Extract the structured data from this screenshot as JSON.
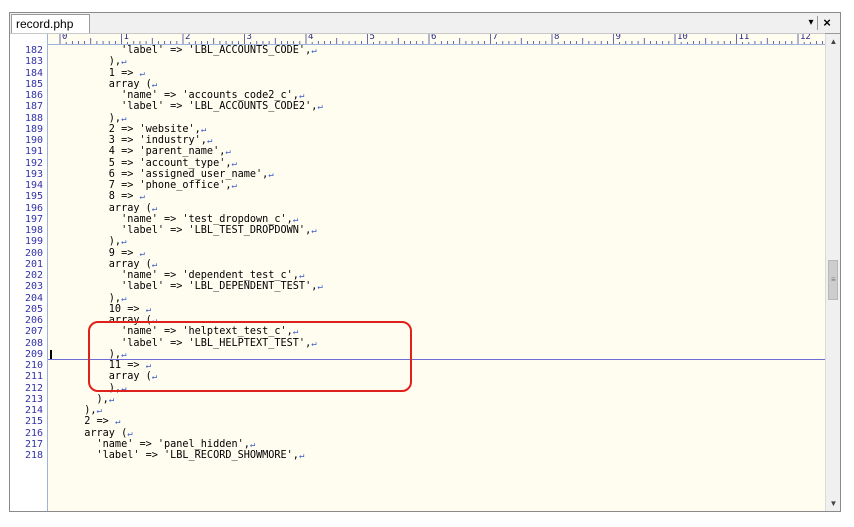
{
  "tab": {
    "label": "record.php"
  },
  "toolbar": {
    "dropdown_glyph": "▾",
    "close_glyph": "×"
  },
  "ruler": {
    "labels": [
      "0",
      "1",
      "2",
      "3",
      "4",
      "5",
      "6",
      "7",
      "8",
      "9",
      "10",
      "11",
      "12"
    ]
  },
  "eol_glyph": "↵",
  "scrollbar": {
    "up_glyph": "▲",
    "down_glyph": "▼",
    "grip_glyph": "≡"
  },
  "current_line": "209",
  "lines": [
    {
      "n": "182",
      "text": "        'label' => 'LBL_ACCOUNTS_CODE',"
    },
    {
      "n": "183",
      "text": "      ),"
    },
    {
      "n": "184",
      "text": "      1 => "
    },
    {
      "n": "185",
      "text": "      array ("
    },
    {
      "n": "186",
      "text": "        'name' => 'accounts_code2_c',"
    },
    {
      "n": "187",
      "text": "        'label' => 'LBL_ACCOUNTS_CODE2',"
    },
    {
      "n": "188",
      "text": "      ),"
    },
    {
      "n": "189",
      "text": "      2 => 'website',"
    },
    {
      "n": "190",
      "text": "      3 => 'industry',"
    },
    {
      "n": "191",
      "text": "      4 => 'parent_name',"
    },
    {
      "n": "192",
      "text": "      5 => 'account_type',"
    },
    {
      "n": "193",
      "text": "      6 => 'assigned_user_name',"
    },
    {
      "n": "194",
      "text": "      7 => 'phone_office',"
    },
    {
      "n": "195",
      "text": "      8 => "
    },
    {
      "n": "196",
      "text": "      array ("
    },
    {
      "n": "197",
      "text": "        'name' => 'test_dropdown_c',"
    },
    {
      "n": "198",
      "text": "        'label' => 'LBL_TEST_DROPDOWN',"
    },
    {
      "n": "199",
      "text": "      ),"
    },
    {
      "n": "200",
      "text": "      9 => "
    },
    {
      "n": "201",
      "text": "      array ("
    },
    {
      "n": "202",
      "text": "        'name' => 'dependent_test_c',"
    },
    {
      "n": "203",
      "text": "        'label' => 'LBL_DEPENDENT_TEST',"
    },
    {
      "n": "204",
      "text": "      ),"
    },
    {
      "n": "205",
      "text": "      10 => "
    },
    {
      "n": "206",
      "text": "      array ("
    },
    {
      "n": "207",
      "text": "        'name' => 'helptext_test_c',"
    },
    {
      "n": "208",
      "text": "        'label' => 'LBL_HELPTEXT_TEST',"
    },
    {
      "n": "209",
      "text": "      ),"
    },
    {
      "n": "210",
      "text": "      11 => "
    },
    {
      "n": "211",
      "text": "      array ("
    },
    {
      "n": "212",
      "text": "      ),"
    },
    {
      "n": "213",
      "text": "    ),"
    },
    {
      "n": "214",
      "text": "  ),"
    },
    {
      "n": "215",
      "text": "  2 => "
    },
    {
      "n": "216",
      "text": "  array ("
    },
    {
      "n": "217",
      "text": "    'name' => 'panel_hidden',"
    },
    {
      "n": "218",
      "text": "    'label' => 'LBL_RECORD_SHOWMORE',"
    }
  ],
  "colors": {
    "line_number": "#3232a8",
    "eol": "#3a5fcd",
    "highlight": "#e0201a",
    "editor_bg": "#fffdf0"
  }
}
